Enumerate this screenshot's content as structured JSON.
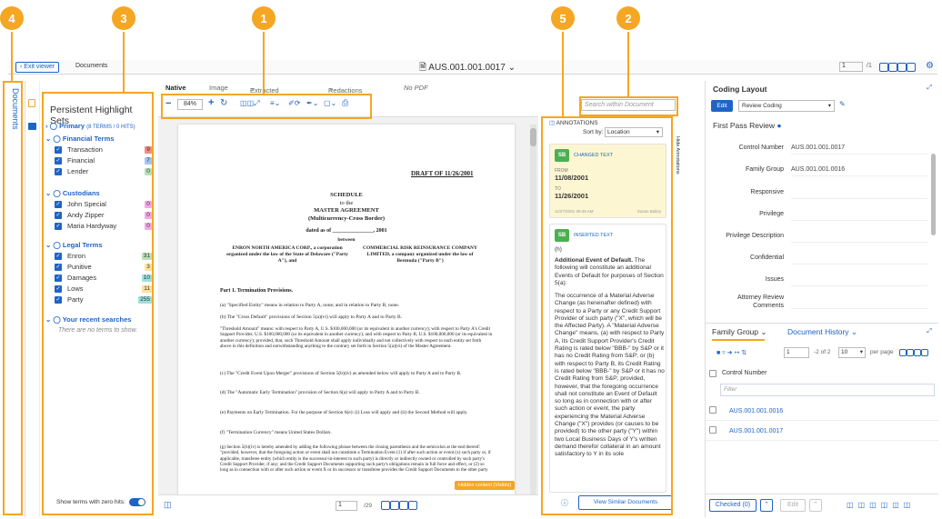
{
  "callouts": {
    "c1": "1",
    "c2": "2",
    "c3": "3",
    "c4": "4",
    "c5": "5"
  },
  "header": {
    "exit_viewer": "Exit viewer",
    "documents": "Documents",
    "doc_id": "AUS.001.001.0017",
    "page_input": "1",
    "page_total": "/1"
  },
  "leftrail": {
    "documents_label": "Documents"
  },
  "highlight": {
    "title": "Persistent Highlight Sets",
    "primary": "Primary",
    "primary_meta": "(8 TERMS / 0 HITS)",
    "groups": [
      {
        "name": "Financial Terms",
        "terms": [
          {
            "t": "Transaction",
            "c": "9",
            "col": "#f28b82"
          },
          {
            "t": "Financial",
            "c": "7",
            "col": "#9fc5f8"
          },
          {
            "t": "Lender",
            "c": "0",
            "col": "#b7e1b6"
          }
        ]
      },
      {
        "name": "Custodians",
        "terms": [
          {
            "t": "John Special",
            "c": "0",
            "col": "#f5a8e8"
          },
          {
            "t": "Andy Zipper",
            "c": "0",
            "col": "#f5a8e8"
          },
          {
            "t": "Maria Hardyway",
            "c": "0",
            "col": "#f5a8e8"
          }
        ]
      },
      {
        "name": "Legal Terms",
        "terms": [
          {
            "t": "Enron",
            "c": "31",
            "col": "#b7e1b6"
          },
          {
            "t": "Punitive",
            "c": "3",
            "col": "#fde29a"
          },
          {
            "t": "Damages",
            "c": "10",
            "col": "#9fe0de"
          },
          {
            "t": "Lows",
            "c": "11",
            "col": "#fde29a"
          },
          {
            "t": "Party",
            "c": "255",
            "col": "#9fe0de"
          }
        ]
      }
    ],
    "recent": "Your recent searches",
    "recent_empty": "There are no terms to show.",
    "zero_hits": "Show terms with zero hits:"
  },
  "viewer": {
    "tabs": [
      "Native",
      "Image",
      "Extracted Text",
      "Redactions",
      "No PDF"
    ],
    "zoom": "84%",
    "search_placeholder": "Search within Document",
    "hidden_content": "Hidden content (Visible)",
    "page_input": "1",
    "page_total": "/29",
    "hide_annotations": "Hide Annotations"
  },
  "doc": {
    "draft": "DRAFT OF 11/26/2001",
    "schedule": "SCHEDULE",
    "to_the": "to the",
    "master": "MASTER AGREEMENT",
    "multicurrency": "(Multicurrency-Cross Border)",
    "dated": "dated as of _______________, 2001",
    "between": "between",
    "left_party": "ENRON NORTH AMERICA CORP., a corporation organized under the law of the State of Delaware (\"Party A\"), and",
    "right_party": "COMMERCIAL RISK REINSURANCE COMPANY LIMITED, a company organized under the law of Bermuda (\"Party B\")",
    "part1": "Part 1. Termination Provisions.",
    "pa": "(a)      \"Specified Entity\" means in relation to Party A, none; and in relation to Party B, none.",
    "pb": "(b)      The \"Cross Default\" provisions of Section 5(a)(vi) will apply to Party A and to Party B.",
    "threshold": "\"Threshold Amount\" means: with respect to Party A, U.S. $100,000,000 (or its equivalent in another currency); with respect to Party A's Credit Support Provider, U.S. $100,000,000 (or its equivalent in another currency); and with respect to Party B, U.S. $100,000,000 (or its equivalent in another currency); provided, that, such Threshold Amount shall apply individually and not collectively with respect to each entity set forth above in this definition and notwithstanding anything to the contrary set forth in Section 5(a)(vi) of the Master Agreement.",
    "pc": "(c)      The \"Credit Event Upon Merger\" provisions of Section 5(b)(iv) as amended below will apply to Party A and to Party B.",
    "pd": "(d)      The \"Automatic Early Termination\" provision of Section 6(a) will apply to Party A and to Party B.",
    "pe": "(e)      Payments on Early Termination. For the purpose of Section 6(e): (i) Loss will apply and (ii) the Second Method will apply.",
    "pf": "(f)      \"Termination Currency\" means United States Dollars.",
    "pg": "(g)      Section 5(b)(iv) is hereby amended by adding the following phrase between the closing parenthesis and the semicolon at the end thereof: \"provided, however, that the foregoing action or event shall not constitute a Termination Event (1) if after such action or event (x) such party or, if applicable, transferee entity (which entity is the successor-in-interest to such party) is directly or indirectly owned or controlled by such party's Credit Support Provider, if any; and the Credit Support Documents supporting such party's obligations remain in full force and effect, or (2) so long as in connection with or after such action or event X or its successor or transferee provides the Credit Support Documents to the other party"
  },
  "annotations": {
    "title": "ANNOTATIONS",
    "sort_by": "Sort by:",
    "sort_value": "Location",
    "card1": {
      "initials": "SB",
      "type": "CHANGED TEXT",
      "from_label": "FROM",
      "from": "11/08/2001",
      "to_label": "TO",
      "to": "11/26/2001",
      "date": "11/27/2001 09:45 AM",
      "user": "Susan Bailey"
    },
    "card2": {
      "initials": "SB",
      "type": "INSERTED TEXT",
      "h": "(h)",
      "title": "Additional Event of Default.",
      "intro": " The following will constitute an additional Events of Default for purposes of Section 5(a):",
      "body": "The occurrence of a Material Adverse Change (as hereinafter defined) with respect to a Party or any Credit Support Provider of such party (\"X\", which will be the Affected Party). A \"Material Adverse Change\" means, (a) with respect to Party A, its Credit Support Provider's Credit Rating is rated below \"BBB-\" by S&P or it has no Credit Rating from S&P; or (b) with respect to Party B, its Credit Rating is rated below \"BBB-\" by S&P or it has no Credit Rating from S&P; provided, however, that the foregoing occurrence shall not constitute an Event of Default so long as in connection with or after such action or event, the party experiencing the Material Adverse Change (\"X\") provides (or causes to be provided) to the other party (\"Y\") within two Local Business Days of Y's written demand therefor collateral in an amount satisfactory to Y in its sole"
    },
    "view_similar": "View Similar Documents"
  },
  "coding": {
    "title": "Coding Layout",
    "edit": "Edit",
    "layout": "Review Coding",
    "section": "First Pass Review",
    "fields": [
      {
        "label": "Control Number",
        "value": "AUS.001.001.0017"
      },
      {
        "label": "Family Group",
        "value": "AUS.001.001.0016"
      },
      {
        "label": "Responsive",
        "value": ""
      },
      {
        "label": "Privilege",
        "value": ""
      },
      {
        "label": "Privilege Description",
        "value": ""
      },
      {
        "label": "Confidential",
        "value": ""
      },
      {
        "label": "Issues",
        "value": ""
      },
      {
        "label": "Attorney Review Comments",
        "value": ""
      }
    ]
  },
  "family": {
    "tab1": "Family Group",
    "tab2": "Document History",
    "page_input": "1",
    "page_total": "-2 of 2",
    "per_page": "10",
    "per_page_label": "per page",
    "col": "Control Number",
    "filter_placeholder": "Filter",
    "rows": [
      "AUS.001.001.0016",
      "AUS.001.001.0017"
    ],
    "checked": "Checked (0)",
    "edit": "Edit"
  }
}
